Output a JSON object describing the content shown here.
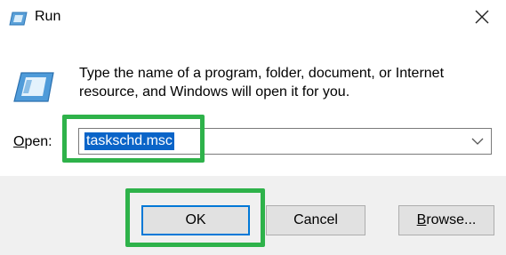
{
  "window": {
    "title": "Run",
    "icon": "run-icon",
    "close_icon": "close-icon"
  },
  "content": {
    "description": "Type the name of a program, folder, document, or Internet resource, and Windows will open it for you.",
    "open_label_prefix": "O",
    "open_label_rest": "pen:",
    "combo_value": "taskschd.msc",
    "combo_arrow_icon": "chevron-down-icon"
  },
  "buttons": {
    "ok": "OK",
    "cancel": "Cancel",
    "browse_prefix": "B",
    "browse_rest": "rowse..."
  },
  "colors": {
    "highlight_box": "#2eb24a",
    "selection": "#0a64c8",
    "footer_bg": "#f0f0f0"
  }
}
